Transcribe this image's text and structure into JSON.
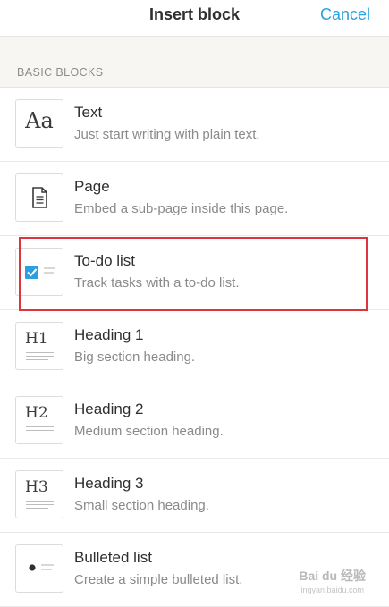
{
  "header": {
    "title": "Insert block",
    "cancel_label": "Cancel"
  },
  "section": {
    "label": "BASIC BLOCKS"
  },
  "items": [
    {
      "title": "Text",
      "description": "Just start writing with plain text.",
      "icon_text": "Aa",
      "icon": "text-icon"
    },
    {
      "title": "Page",
      "description": "Embed a sub-page inside this page.",
      "icon": "page-icon"
    },
    {
      "title": "To-do list",
      "description": "Track tasks with a to-do list.",
      "icon": "todo-checkbox-icon",
      "highlighted": true
    },
    {
      "title": "Heading 1",
      "description": "Big section heading.",
      "icon_text": "H1",
      "icon": "heading-1-icon"
    },
    {
      "title": "Heading 2",
      "description": "Medium section heading.",
      "icon_text": "H2",
      "icon": "heading-2-icon"
    },
    {
      "title": "Heading 3",
      "description": "Small section heading.",
      "icon_text": "H3",
      "icon": "heading-3-icon"
    },
    {
      "title": "Bulleted list",
      "description": "Create a simple bulleted list.",
      "icon": "bullet-icon"
    }
  ],
  "watermark": {
    "text": "Bai du 经验",
    "subtext": "jingyan.baidu.com"
  },
  "colors": {
    "accent": "#2aa3e0",
    "checkbox": "#2e9ee0",
    "highlight": "#d9373b"
  }
}
